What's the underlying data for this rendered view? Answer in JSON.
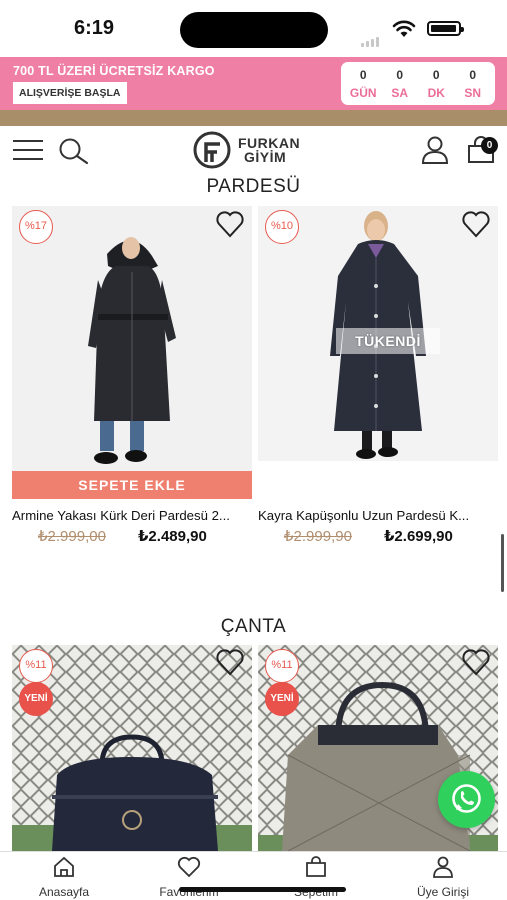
{
  "status_bar": {
    "time": "6:19"
  },
  "promo": {
    "title": "700 TL ÜZERİ ÜCRETSİZ KARGO",
    "cta": "ALIŞVERİŞE BAŞLA",
    "countdown": [
      {
        "value": "0",
        "label": "GÜN"
      },
      {
        "value": "0",
        "label": "SA"
      },
      {
        "value": "0",
        "label": "DK"
      },
      {
        "value": "0",
        "label": "SN"
      }
    ],
    "colors": {
      "banner": "#f07fa6",
      "strip": "#a98f69"
    }
  },
  "header": {
    "logo_line1": "FURKAN",
    "logo_line2": "GİYİM",
    "cart_count": "0",
    "icons": [
      "menu-icon",
      "search-icon",
      "user-icon",
      "cart-icon"
    ]
  },
  "sections": [
    {
      "title": "PARDESÜ",
      "products": [
        {
          "discount": "%17",
          "name": "Armine Yakası Kürk Deri Pardesü 2...",
          "old_price": "₺2.999,00",
          "price": "₺2.489,90",
          "cta": "SEPETE EKLE"
        },
        {
          "discount": "%10",
          "name": "Kayra Kapüşonlu Uzun Pardesü K...",
          "old_price": "₺2.999,90",
          "price": "₺2.699,90",
          "sold_out": "TÜKENDİ"
        }
      ]
    },
    {
      "title": "ÇANTA",
      "products": [
        {
          "discount": "%11",
          "badge": "YENİ"
        },
        {
          "discount": "%11",
          "badge": "YENİ"
        }
      ]
    }
  ],
  "bottom_nav": [
    {
      "label": "Anasayfa",
      "icon": "home-icon"
    },
    {
      "label": "Favorilerim",
      "icon": "heart-icon"
    },
    {
      "label": "Sepetim",
      "icon": "bag-icon"
    },
    {
      "label": "Üye Girişi",
      "icon": "user-icon"
    }
  ],
  "accent_colors": {
    "add_to_cart": "#ef7f6e",
    "discount": "#e65a4f",
    "whatsapp": "#2fd05c"
  }
}
